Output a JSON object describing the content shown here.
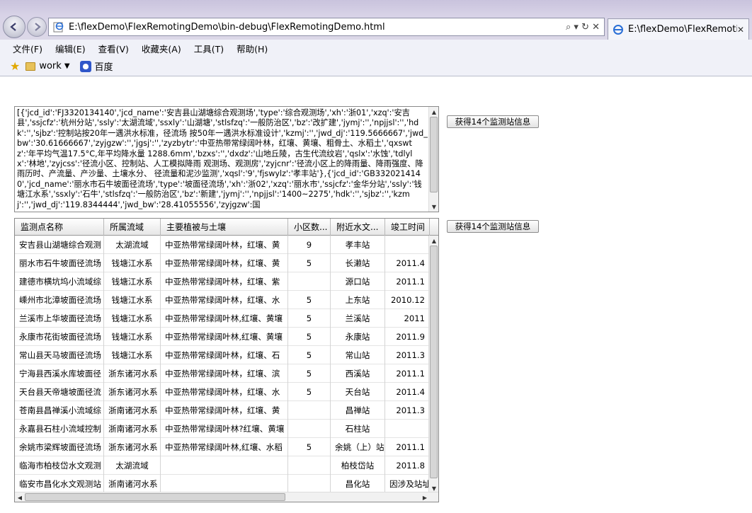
{
  "browser": {
    "address_url": "E:\\flexDemo\\FlexRemotingDemo\\bin-debug\\FlexRemotingDemo.html",
    "address_controls": "⌕ ▾ ↻ ✕",
    "tab_title": "E:\\flexDemo\\FlexRemotin...",
    "tab_close": "✕"
  },
  "menu": [
    "文件(F)",
    "编辑(E)",
    "查看(V)",
    "收藏夹(A)",
    "工具(T)",
    "帮助(H)"
  ],
  "favorites": {
    "items": [
      {
        "label": "work",
        "icon": "folder-icon"
      },
      {
        "label": "百度",
        "icon": "baidu-icon"
      }
    ]
  },
  "textarea": {
    "text": "[{'jcd_id':'FJ3320134140','jcd_name':'安吉县山湖塘综合观测场','type':'综合观测场','xh':'浙01','xzq':'安吉县','ssjcfz':'杭州分站','ssly':'太湖流域','ssxly':'山湖塘','stlsfzq':'一般防治区','bz':'改扩建','jymj':'','npjjsl':'','hdk':'','sjbz':'控制站按20年一遇洪水标准，径流场 按50年一遇洪水标准设计','kzmj':'','jwd_dj':'119.5666667','jwd_bw':'30.61666667','zyjgzw':'','jgsj':'','zyzbytr':'中亚热带常绿阔叶林，红壤、黄壤、粗骨土、水稻土','qxswtz':'年平均气温17.5°C,年平均降水量 1288.6mm','bzxs':'','dxdz':'山地丘陵，古生代流纹岩','qslx':'水蚀','tdlylx':'林地','zyjcss':'径流小区、控制站、人工模拟降雨 观测场、观测房','zyjcnr':'径流小区上的降雨量、降雨强度、降 雨历时、产流量、产沙量、土壤水分、 径流量和泥沙监测','xqsl':'9','fjswylz':'孝丰站'},{'jcd_id':'GB3320214140','jcd_name':'丽水市石牛坡面径流场','type':'坡面径流场','xh':'浙02','xzq':'丽水市','ssjcfz':'金华分站','ssly':'钱塘江水系','ssxly':'石牛','stlsfzq':'一般防治区','bz':'新建','jymj':'','npjjsl':'1400~2275','hdk':'','sjbz':'','kzmj':'','jwd_dj':'119.8344444','jwd_bw':'28.41055556','zyjgzw':国"
  },
  "buttons": {
    "get_stations_1": "获得14个监测站信息",
    "get_stations_2": "获得14个监测站信息"
  },
  "grid": {
    "columns": [
      "监测点名称",
      "所属流域",
      "主要植被与土壤",
      "小区数...",
      "附近水文...",
      "竣工时间"
    ],
    "rows": [
      [
        "安吉县山湖塘综合观测",
        "太湖流域",
        "中亚热带常绿阔叶林，红壤、黄",
        "9",
        "孝丰站",
        ""
      ],
      [
        "丽水市石牛坡面径流场",
        "钱塘江水系",
        "中亚热带常绿阔叶林，红壤、黄",
        "5",
        "长濑站",
        "2011.4"
      ],
      [
        "建德市横坑坞小流域综",
        "钱塘江水系",
        "中亚热带常绿阔叶林，红壤、紫",
        "",
        "源口站",
        "2011.1"
      ],
      [
        "嵊州市北漳坡面径流场",
        "钱塘江水系",
        "中亚热带常绿阔叶林，红壤、水",
        "5",
        "上东站",
        "2010.12"
      ],
      [
        "兰溪市上华坡面径流场",
        "钱塘江水系",
        "中亚热带常绿阔叶林,红壤、黄壤",
        "5",
        "兰溪站",
        "2011"
      ],
      [
        "永康市花街坡面径流场",
        "钱塘江水系",
        "中亚热带常绿阔叶林,红壤、黄壤",
        "5",
        "永康站",
        "2011.9"
      ],
      [
        "常山县天马坡面径流场",
        "钱塘江水系",
        "中亚热带常绿阔叶林，红壤、石",
        "5",
        "常山站",
        "2011.3"
      ],
      [
        "宁海县西溪水库坡面径",
        "浙东诸河水系",
        "中亚热带常绿阔叶林，红壤、滨",
        "5",
        "西溪站",
        "2011.1"
      ],
      [
        "天台县天帝塘坡面径流",
        "浙东诸河水系",
        "中亚热带常绿阔叶林，红壤、水",
        "5",
        "天台站",
        "2011.4"
      ],
      [
        "苍南县昌禅溪小流域综",
        "浙南诸河水系",
        "中亚热带常绿阔叶林，红壤、黄",
        "",
        "昌禅站",
        "2011.3"
      ],
      [
        "永嘉县石柱小流域控制",
        "浙南诸河水系",
        "中亚热带常绿阔叶林?红壤、黄壤",
        "",
        "石柱站",
        ""
      ],
      [
        "余姚市梁辉坡面径流场",
        "浙东诸河水系",
        "中亚热带常绿阔叶林,红壤、水稻",
        "5",
        "余姚（上）站",
        "2011.1"
      ],
      [
        "临海市柏枝岱水文观测",
        "太湖流域",
        "",
        "",
        "柏枝岱站",
        "2011.8"
      ],
      [
        "临安市昌化水文观测站",
        "浙南诸河水系",
        "",
        "",
        "昌化站",
        "因涉及站址"
      ]
    ]
  },
  "scroll": {
    "textarea_thumb_fraction": 0.88,
    "grid_v_thumb_fraction": 0.98,
    "grid_h_thumb_fraction": 0.66
  }
}
